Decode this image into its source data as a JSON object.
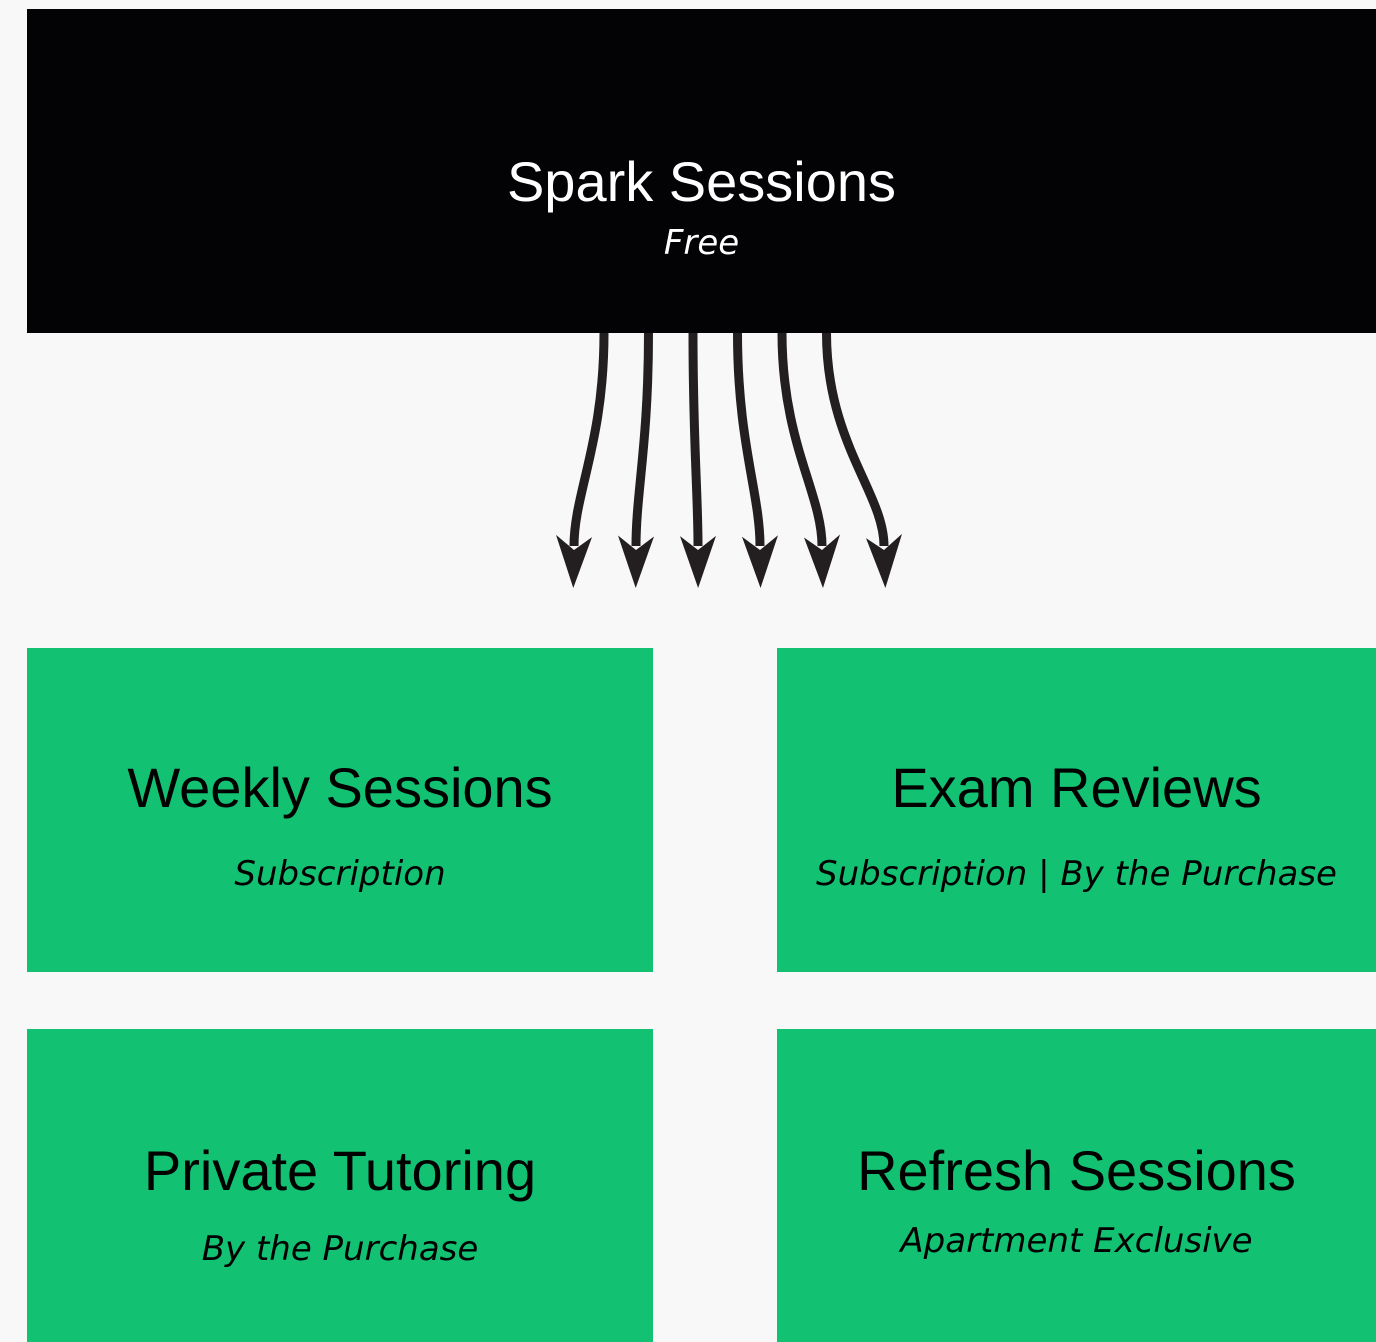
{
  "colors": {
    "background": "#f8f8f8",
    "top_box": "#030305",
    "tier_box": "#12c272",
    "arrow": "#231f20"
  },
  "top": {
    "title": "Spark Sessions",
    "subtitle": "Free"
  },
  "tiers": [
    {
      "title": "Weekly Sessions",
      "subtitle": "Subscription"
    },
    {
      "title": "Exam Reviews",
      "subtitle": "Subscription | By the Purchase"
    },
    {
      "title": "Private Tutoring",
      "subtitle": "By the Purchase"
    },
    {
      "title": "Refresh Sessions",
      "subtitle": "Apartment Exclusive"
    }
  ],
  "connector": {
    "icon": "downward-arrows-icon",
    "arrow_count": 6
  }
}
